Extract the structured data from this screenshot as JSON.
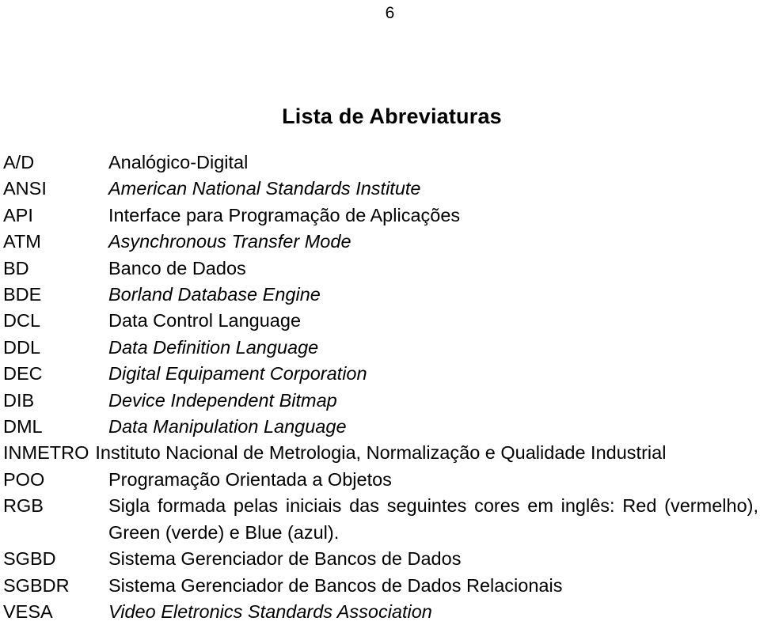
{
  "page": {
    "number": "6",
    "title": "Lista de Abreviaturas"
  },
  "abbreviations": [
    {
      "term": "A/D",
      "definition": "Analógico-Digital",
      "italic": false,
      "justified": false,
      "wide_term": false
    },
    {
      "term": "ANSI",
      "definition": "American National Standards Institute",
      "italic": true,
      "justified": false,
      "wide_term": false
    },
    {
      "term": "API",
      "definition": "Interface para Programação de Aplicações",
      "italic": false,
      "justified": false,
      "wide_term": false
    },
    {
      "term": "ATM",
      "definition": "Asynchronous Transfer Mode",
      "italic": true,
      "justified": false,
      "wide_term": false
    },
    {
      "term": "BD",
      "definition": "Banco de Dados",
      "italic": false,
      "justified": false,
      "wide_term": false
    },
    {
      "term": "BDE",
      "definition": "Borland Database Engine",
      "italic": true,
      "justified": false,
      "wide_term": false
    },
    {
      "term": "DCL",
      "definition": "Data Control Language",
      "italic": false,
      "justified": false,
      "wide_term": false
    },
    {
      "term": "DDL",
      "definition": "Data Definition Language",
      "italic": true,
      "justified": false,
      "wide_term": false
    },
    {
      "term": "DEC",
      "definition": "Digital Equipament Corporation",
      "italic": true,
      "justified": false,
      "wide_term": false
    },
    {
      "term": "DIB",
      "definition": "Device Independent Bitmap",
      "italic": true,
      "justified": false,
      "wide_term": false
    },
    {
      "term": "DML",
      "definition": "Data Manipulation Language",
      "italic": true,
      "justified": false,
      "wide_term": false
    },
    {
      "term": "INMETRO",
      "definition": "Instituto Nacional de Metrologia, Normalização e Qualidade Industrial",
      "italic": false,
      "justified": false,
      "wide_term": true
    },
    {
      "term": "POO",
      "definition": "Programação Orientada a Objetos",
      "italic": false,
      "justified": false,
      "wide_term": false
    },
    {
      "term": "RGB",
      "definition": "Sigla formada pelas iniciais das seguintes cores em inglês: Red (vermelho), Green (verde) e Blue (azul).",
      "italic": false,
      "justified": true,
      "wide_term": false
    },
    {
      "term": "SGBD",
      "definition": "Sistema Gerenciador de Bancos de Dados",
      "italic": false,
      "justified": false,
      "wide_term": false
    },
    {
      "term": "SGBDR",
      "definition": "Sistema Gerenciador de Bancos de Dados Relacionais",
      "italic": false,
      "justified": false,
      "wide_term": false
    },
    {
      "term": "VESA",
      "definition": "Video Eletronics Standards Association",
      "italic": true,
      "justified": false,
      "wide_term": false
    }
  ]
}
